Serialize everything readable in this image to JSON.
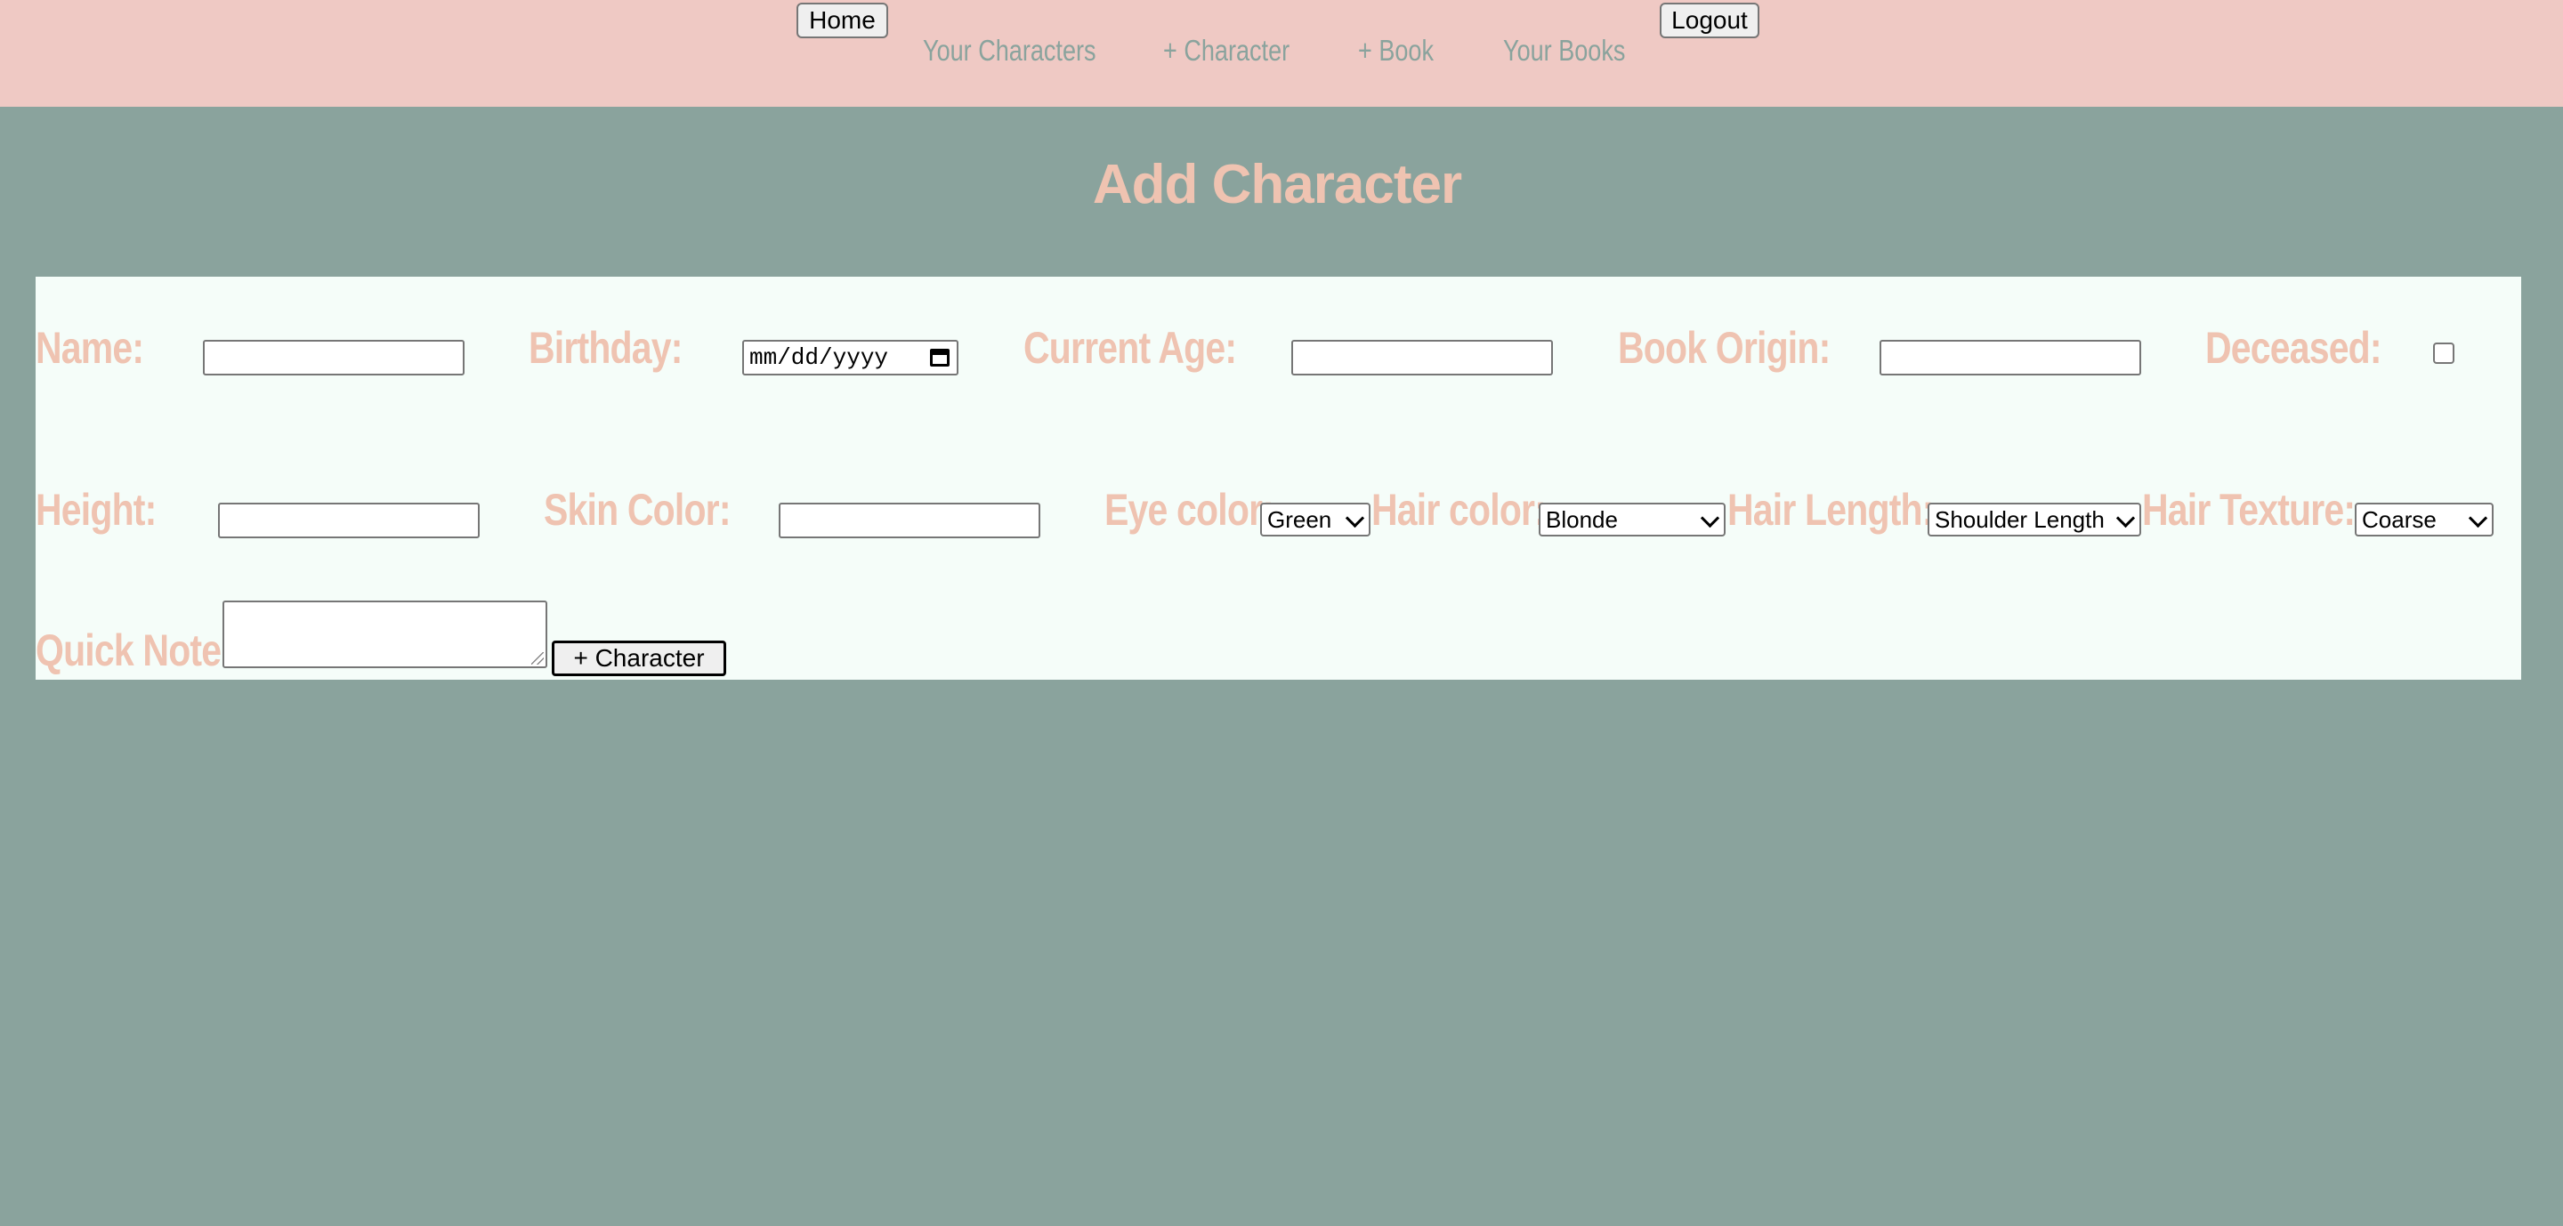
{
  "nav": {
    "home_label": "Home",
    "logout_label": "Logout",
    "links": [
      "Your Characters",
      "+ Character",
      "+ Book",
      "Your Books"
    ]
  },
  "page_title": "Add Character",
  "form": {
    "name_label": "Name:",
    "birthday_label": "Birthday:",
    "birthday_placeholder": "mm/dd/yyyy",
    "current_age_label": "Current Age:",
    "book_origin_label": "Book Origin:",
    "deceased_label": "Deceased:",
    "height_label": "Height:",
    "skin_color_label": "Skin Color:",
    "eye_color_label": "Eye color:",
    "eye_color_value": "Green",
    "hair_color_label": "Hair color:",
    "hair_color_value": "Blonde",
    "hair_length_label": "Hair Length:",
    "hair_length_value": "Shoulder Length",
    "hair_texture_label": "Hair Texture:",
    "hair_texture_value": "Coarse",
    "quick_note_label": "Quick Note:",
    "submit_label": "+ Character"
  },
  "colors": {
    "nav_bg": "#efc9c4",
    "page_bg": "#8aa39d",
    "card_bg": "#f5fdf9",
    "label_color": "#efc3b1"
  }
}
